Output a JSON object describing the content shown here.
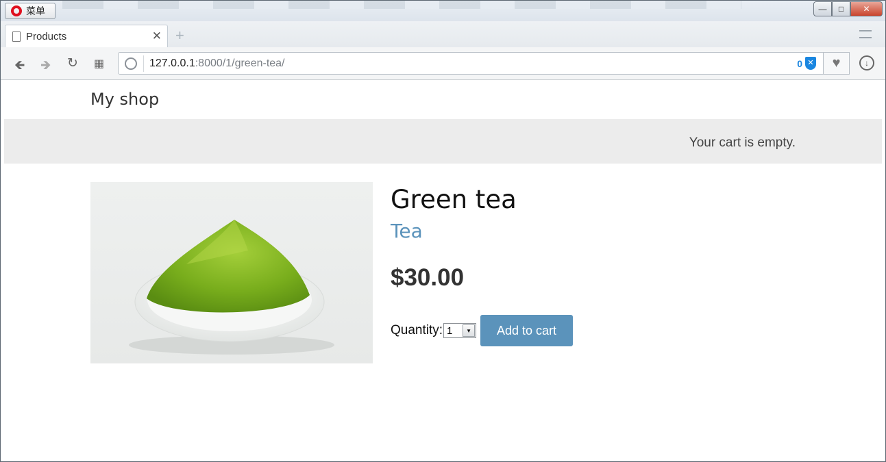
{
  "browser": {
    "menu_label": "菜单",
    "tab_title": "Products",
    "url_host": "127.0.0.1",
    "url_path": ":8000/1/green-tea/",
    "blocked_count": "0"
  },
  "site": {
    "logo": "My shop",
    "cart_status": "Your cart is empty."
  },
  "product": {
    "name": "Green tea",
    "category": "Tea",
    "price": "$30.00",
    "quantity_label": "Quantity:",
    "quantity_value": "1",
    "add_to_cart_label": "Add to cart",
    "image_alt": "green tea powder in white bowl"
  },
  "colors": {
    "accent": "#5b93bb",
    "subheader_bg": "#ececec",
    "matcha": "#7fb21d"
  }
}
